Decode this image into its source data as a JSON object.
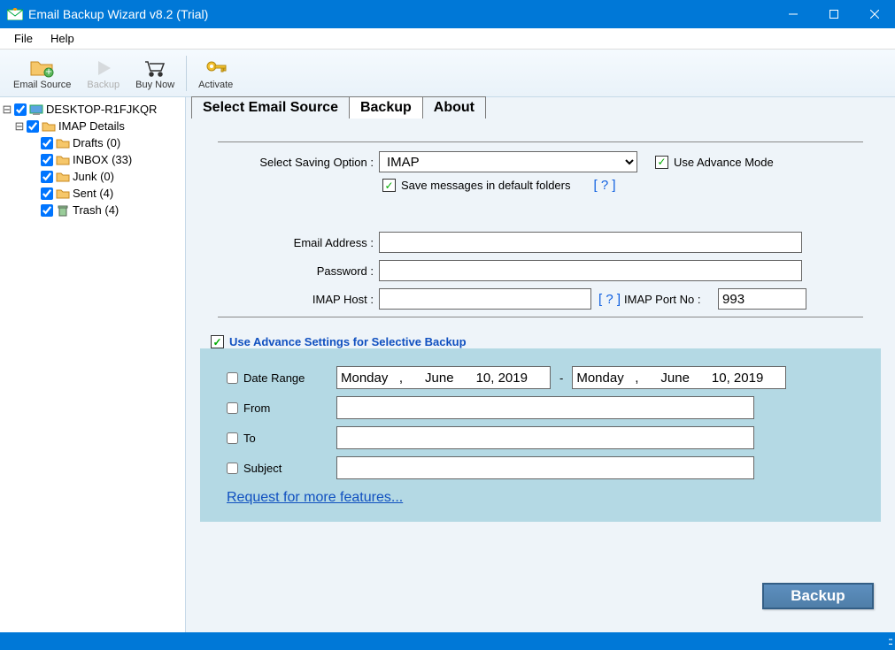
{
  "titlebar": {
    "title": "Email Backup Wizard v8.2 (Trial)"
  },
  "menu": {
    "file": "File",
    "help": "Help"
  },
  "toolbar": {
    "email_source": "Email Source",
    "backup": "Backup",
    "buy_now": "Buy Now",
    "activate": "Activate"
  },
  "tree": {
    "root": "DESKTOP-R1FJKQR",
    "imap": "IMAP Details",
    "drafts": "Drafts (0)",
    "inbox": "INBOX (33)",
    "junk": "Junk (0)",
    "sent": "Sent (4)",
    "trash": "Trash (4)"
  },
  "tabs": {
    "select": "Select Email Source",
    "backup": "Backup",
    "about": "About"
  },
  "form": {
    "saving_label": "Select Saving Option :",
    "saving_value": "IMAP",
    "use_advance_mode": "Use Advance Mode",
    "save_default": "Save messages in default folders",
    "help_q": "[ ? ]",
    "email_label": "Email Address :",
    "password_label": "Password :",
    "imap_host_label": "IMAP Host :",
    "port_label": "IMAP Port No :",
    "port_value": "993",
    "email_val": "",
    "password_val": "",
    "imap_host_val": ""
  },
  "advance": {
    "title": "Use Advance Settings for Selective Backup",
    "date_range": "Date Range",
    "date1": "Monday   ,      June      10, 2019",
    "date_sep": "-",
    "date2": "Monday   ,      June      10, 2019",
    "from": "From",
    "to": "To",
    "subject": "Subject",
    "from_val": "",
    "to_val": "",
    "subject_val": "",
    "request": "Request for more features..."
  },
  "backup_button": "Backup"
}
